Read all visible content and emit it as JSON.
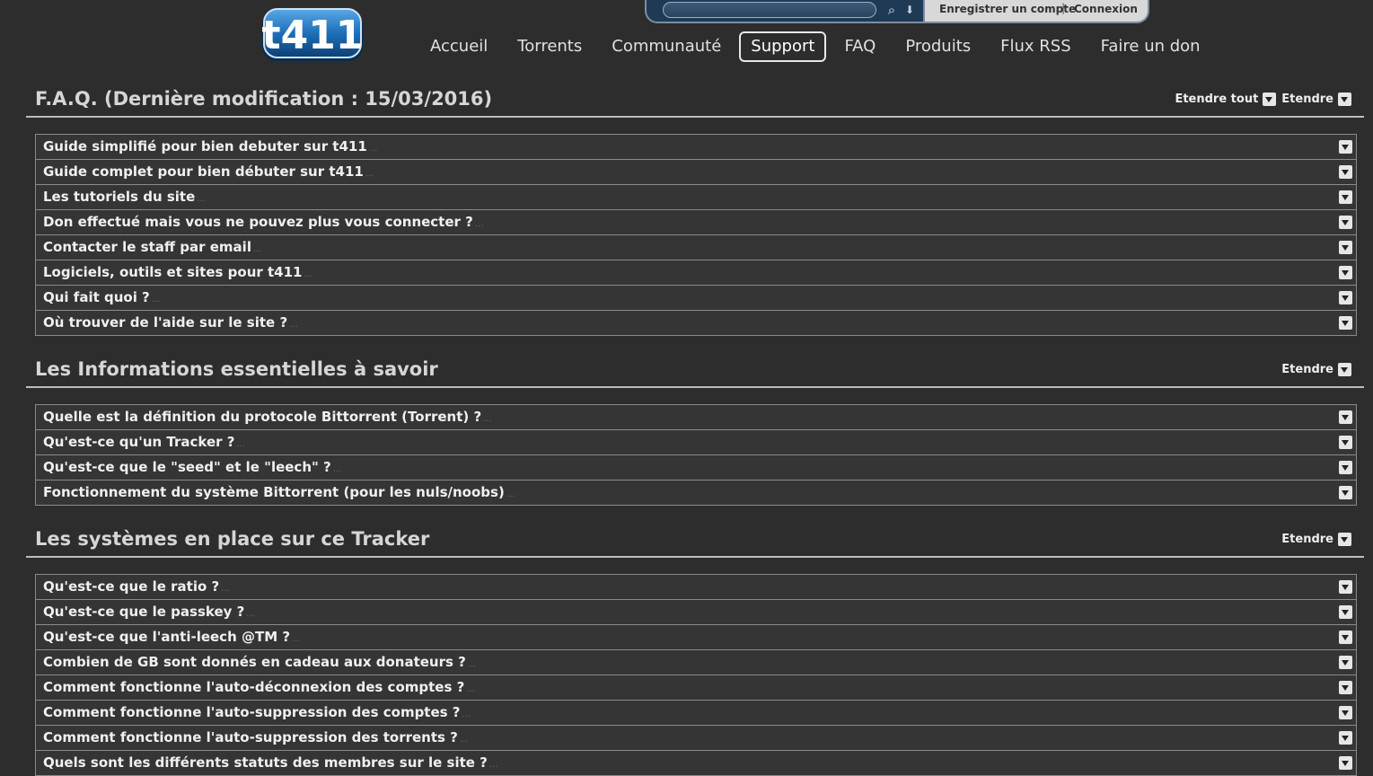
{
  "header": {
    "logo_text": "t411",
    "search": {
      "placeholder": "",
      "value": ""
    },
    "account": {
      "register": "Enregistrer un compte",
      "login": "Connexion"
    },
    "nav": [
      "Accueil",
      "Torrents",
      "Communauté",
      "Support",
      "FAQ",
      "Produits",
      "Flux RSS",
      "Faire un don"
    ],
    "nav_active": "Support"
  },
  "sections": [
    {
      "title": "F.A.Q. (Dernière modification : 15/03/2016)",
      "expand_all": "Etendre tout",
      "expand": "Etendre",
      "items": [
        "Guide simplifié pour bien debuter sur t411",
        "Guide complet pour bien débuter sur t411",
        "Les tutoriels du site",
        "Don effectué mais vous ne pouvez plus vous connecter ?",
        "Contacter le staff par email",
        "Logiciels, outils et sites pour t411",
        "Qui fait quoi ?",
        "Où trouver de l'aide sur le site ?"
      ]
    },
    {
      "title": "Les Informations essentielles à savoir",
      "expand": "Etendre",
      "items": [
        "Quelle est la définition du protocole Bittorrent (Torrent) ?",
        "Qu'est-ce qu'un Tracker ?",
        "Qu'est-ce que le \"seed\" et le \"leech\" ?",
        "Fonctionnement du système Bittorrent (pour les nuls/noobs)"
      ]
    },
    {
      "title": "Les systèmes en place sur ce Tracker",
      "expand": "Etendre",
      "items": [
        "Qu'est-ce que le ratio ?",
        "Qu'est-ce que le passkey ?",
        "Qu'est-ce que l'anti-leech @TM ?",
        "Combien de GB sont donnés en cadeau aux donateurs ?",
        "Comment fonctionne l'auto-déconnexion des comptes ?",
        "Comment fonctionne l'auto-suppression des comptes ?",
        "Comment fonctionne l'auto-suppression des torrents ?",
        "Quels sont les différents statuts des membres sur le site ?"
      ]
    }
  ],
  "item_suffix": "...",
  "colors": {
    "background": "#2d2d2d",
    "accent": "#1f6fb0",
    "link_dots": "#3f6da0"
  }
}
